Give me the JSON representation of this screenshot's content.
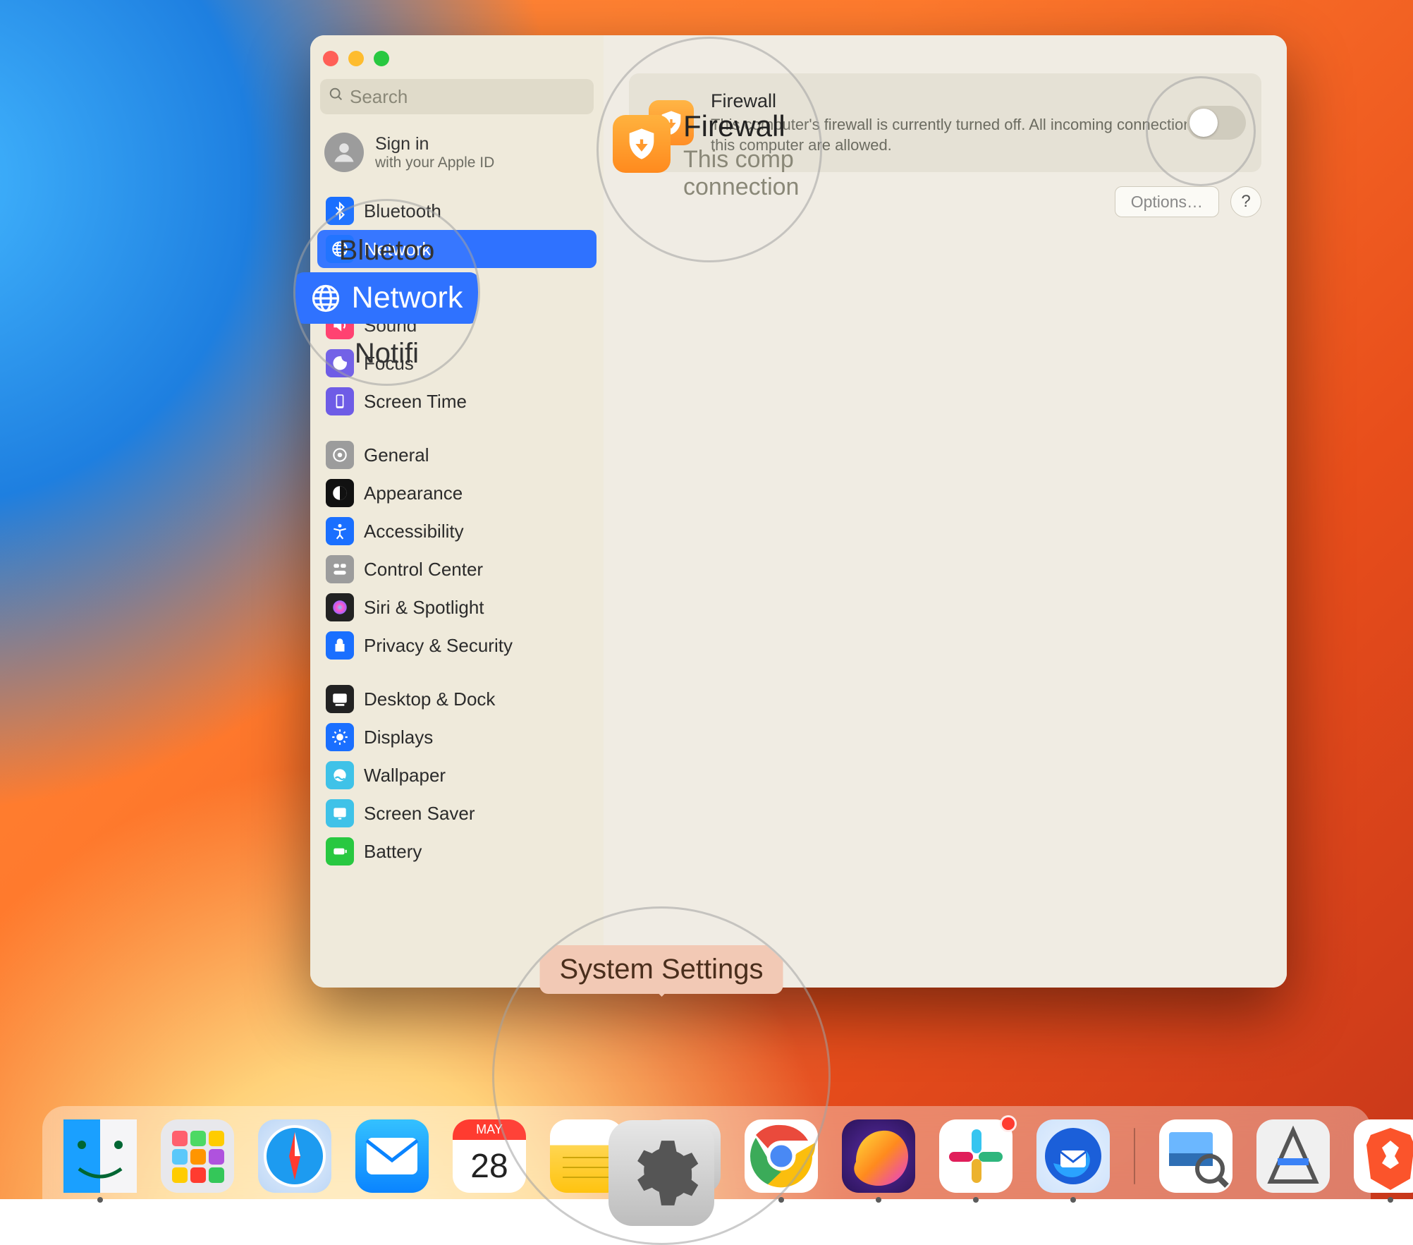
{
  "search": {
    "placeholder": "Search"
  },
  "signin": {
    "title": "Sign in",
    "subtitle": "with your Apple ID"
  },
  "sidebar": {
    "groups": [
      {
        "items": [
          {
            "label": "Bluetooth"
          },
          {
            "label": "Network",
            "selected": true
          },
          {
            "label": "Notifications"
          },
          {
            "label": "Sound"
          },
          {
            "label": "Focus"
          },
          {
            "label": "Screen Time"
          }
        ]
      },
      {
        "items": [
          {
            "label": "General"
          },
          {
            "label": "Appearance"
          },
          {
            "label": "Accessibility"
          },
          {
            "label": "Control Center"
          },
          {
            "label": "Siri & Spotlight"
          },
          {
            "label": "Privacy & Security"
          }
        ]
      },
      {
        "items": [
          {
            "label": "Desktop & Dock"
          },
          {
            "label": "Displays"
          },
          {
            "label": "Wallpaper"
          },
          {
            "label": "Screen Saver"
          },
          {
            "label": "Battery"
          }
        ]
      }
    ]
  },
  "firewall": {
    "title": "Firewall",
    "description": "This computer's firewall is currently turned off. All incoming connections to this computer are allowed.",
    "toggle_on": false,
    "options_label": "Options…",
    "help_label": "?"
  },
  "callouts": {
    "network_above": "Bluetoo",
    "network_main": "Network",
    "network_below": "Notifi",
    "firewall_title": "Firewall",
    "firewall_line1": "This comp",
    "firewall_line2": "connection",
    "dock_tooltip": "System Settings"
  },
  "dock": {
    "items": [
      {
        "name": "finder",
        "running": true
      },
      {
        "name": "launchpad",
        "running": false
      },
      {
        "name": "safari",
        "running": false
      },
      {
        "name": "mail",
        "running": false
      },
      {
        "name": "calendar",
        "running": false,
        "month": "MAY",
        "day": "28"
      },
      {
        "name": "notes",
        "running": false
      },
      {
        "name": "system-settings",
        "running": true
      },
      {
        "name": "chrome",
        "running": true
      },
      {
        "name": "firefox",
        "running": true
      },
      {
        "name": "slack",
        "running": true,
        "badge": true
      },
      {
        "name": "thunderbird",
        "running": true
      },
      {
        "name": "preview",
        "running": false
      },
      {
        "name": "xcode",
        "running": false
      },
      {
        "name": "brave",
        "running": true
      }
    ]
  }
}
